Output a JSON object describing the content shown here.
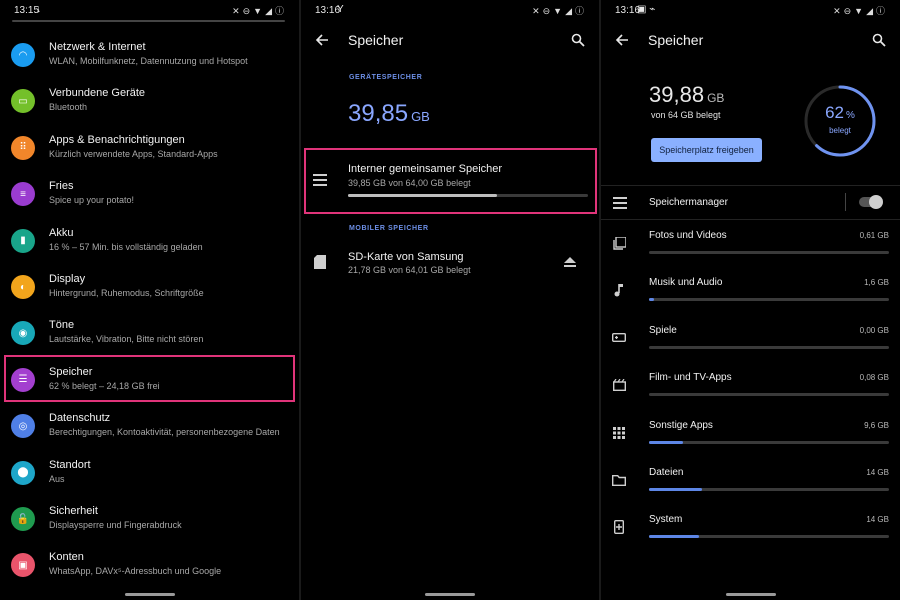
{
  "panel1": {
    "status_time": "13:15",
    "items": [
      {
        "title": "Netzwerk & Internet",
        "sub": "WLAN, Mobilfunknetz, Datennutzung und Hotspot",
        "color": "#1a9cf0",
        "icon": "wifi-icon"
      },
      {
        "title": "Verbundene Geräte",
        "sub": "Bluetooth",
        "color": "#74c02a",
        "icon": "devices-icon"
      },
      {
        "title": "Apps & Benachrichtigungen",
        "sub": "Kürzlich verwendete Apps, Standard-Apps",
        "color": "#f1862a",
        "icon": "apps-icon"
      },
      {
        "title": "Fries",
        "sub": "Spice up your potato!",
        "color": "#9a3ccf",
        "icon": "fries-icon"
      },
      {
        "title": "Akku",
        "sub": "16 % – 57 Min. bis vollständig geladen",
        "color": "#19a58a",
        "icon": "battery-icon"
      },
      {
        "title": "Display",
        "sub": "Hintergrund, Ruhemodus, Schriftgröße",
        "color": "#f2a51c",
        "icon": "display-icon"
      },
      {
        "title": "Töne",
        "sub": "Lautstärke, Vibration, Bitte nicht stören",
        "color": "#18a8b8",
        "icon": "sound-icon"
      },
      {
        "title": "Speicher",
        "sub": "62 % belegt – 24,18 GB frei",
        "color": "#a33fcf",
        "icon": "storage-icon"
      },
      {
        "title": "Datenschutz",
        "sub": "Berechtigungen, Kontoaktivität, personenbezogene Daten",
        "color": "#4f7fe6",
        "icon": "privacy-icon"
      },
      {
        "title": "Standort",
        "sub": "Aus",
        "color": "#1ea6c9",
        "icon": "location-icon"
      },
      {
        "title": "Sicherheit",
        "sub": "Displaysperre und Fingerabdruck",
        "color": "#1f9b4f",
        "icon": "lock-icon"
      },
      {
        "title": "Konten",
        "sub": "WhatsApp, DAVx⁵-Adressbuch und Google",
        "color": "#e9546b",
        "icon": "account-icon"
      }
    ]
  },
  "panel2": {
    "status_time": "13:16",
    "title": "Speicher",
    "device_label": "Gerätespeicher",
    "device_value": "39,85",
    "device_unit": "GB",
    "internal_title": "Interner gemeinsamer Speicher",
    "internal_sub": "39,85 GB von 64,00 GB belegt",
    "internal_progress": 0.62,
    "mobile_label": "Mobiler Speicher",
    "sd_title": "SD-Karte von Samsung",
    "sd_sub": "21,78 GB von 64,01 GB belegt"
  },
  "panel3": {
    "status_time": "13:16",
    "title": "Speicher",
    "used_value": "39,88",
    "used_unit": "GB",
    "used_sub": "von 64 GB belegt",
    "free_button": "Speicherplatz freigeben",
    "ring_value": "62",
    "ring_unit": "%",
    "ring_sub": "belegt",
    "ring_fraction": 0.62,
    "manager_label": "Speichermanager",
    "manager_enabled": false,
    "categories": [
      {
        "title": "Fotos und Videos",
        "value": "0,61 GB",
        "fraction": 0.0,
        "icon": "photos-icon"
      },
      {
        "title": "Musik und Audio",
        "value": "1,6 GB",
        "fraction": 0.02,
        "icon": "music-icon"
      },
      {
        "title": "Spiele",
        "value": "0,00 GB",
        "fraction": 0.0,
        "icon": "games-icon"
      },
      {
        "title": "Film- und TV-Apps",
        "value": "0,08 GB",
        "fraction": 0.0,
        "icon": "movies-icon"
      },
      {
        "title": "Sonstige Apps",
        "value": "9,6 GB",
        "fraction": 0.14,
        "icon": "apps-grid-icon"
      },
      {
        "title": "Dateien",
        "value": "14 GB",
        "fraction": 0.22,
        "icon": "folder-icon"
      },
      {
        "title": "System",
        "value": "14 GB",
        "fraction": 0.21,
        "icon": "system-icon"
      }
    ]
  }
}
